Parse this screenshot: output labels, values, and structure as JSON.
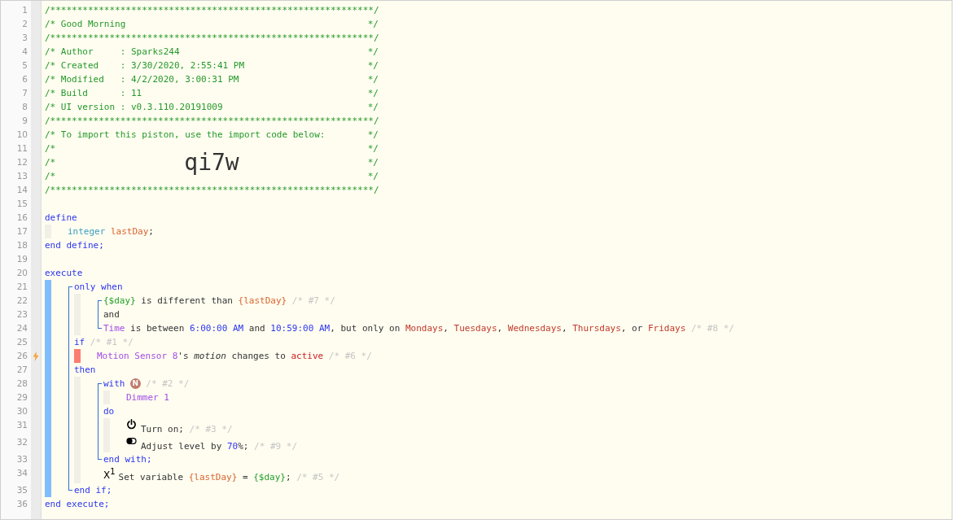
{
  "code": [
    {
      "number": "1",
      "kind": "banner",
      "trigger": false,
      "tokens": [
        {
          "kind": "comment",
          "text": "/************************************************************/"
        }
      ]
    },
    {
      "number": "2",
      "kind": "banner",
      "trigger": false,
      "tokens": [
        {
          "kind": "comment",
          "text": "/* Good Morning"
        },
        {
          "kind": "comment",
          "text": "*/"
        }
      ]
    },
    {
      "number": "3",
      "kind": "banner",
      "trigger": false,
      "tokens": [
        {
          "kind": "comment",
          "text": "/************************************************************/"
        }
      ]
    },
    {
      "number": "4",
      "kind": "banner",
      "trigger": false,
      "tokens": [
        {
          "kind": "comment",
          "text": "/* Author     : Sparks244"
        },
        {
          "kind": "comment",
          "text": "*/"
        }
      ]
    },
    {
      "number": "5",
      "kind": "banner",
      "trigger": false,
      "tokens": [
        {
          "kind": "comment",
          "text": "/* Created    : 3/30/2020, 2:55:41 PM"
        },
        {
          "kind": "comment",
          "text": "*/"
        }
      ]
    },
    {
      "number": "6",
      "kind": "banner",
      "trigger": false,
      "tokens": [
        {
          "kind": "comment",
          "text": "/* Modified   : 4/2/2020, 3:00:31 PM"
        },
        {
          "kind": "comment",
          "text": "*/"
        }
      ]
    },
    {
      "number": "7",
      "kind": "banner",
      "trigger": false,
      "tokens": [
        {
          "kind": "comment",
          "text": "/* Build      : 11"
        },
        {
          "kind": "comment",
          "text": "*/"
        }
      ]
    },
    {
      "number": "8",
      "kind": "banner",
      "trigger": false,
      "tokens": [
        {
          "kind": "comment",
          "text": "/* UI version : v0.3.110.20191009"
        },
        {
          "kind": "comment",
          "text": "*/"
        }
      ]
    },
    {
      "number": "9",
      "kind": "banner",
      "trigger": false,
      "tokens": [
        {
          "kind": "comment",
          "text": "/************************************************************/"
        }
      ]
    },
    {
      "number": "10",
      "kind": "banner",
      "trigger": false,
      "tokens": [
        {
          "kind": "comment",
          "text": "/* To import this piston, use the import code below:"
        },
        {
          "kind": "comment",
          "text": "*/"
        }
      ]
    },
    {
      "number": "11",
      "kind": "banner",
      "trigger": false,
      "tokens": [
        {
          "kind": "comment",
          "text": "/*"
        },
        {
          "kind": "comment",
          "text": "*/"
        }
      ]
    },
    {
      "number": "12",
      "kind": "banner",
      "trigger": false,
      "tokens": [
        {
          "kind": "comment",
          "text": "/*"
        },
        {
          "kind": "code",
          "text": "qi7w"
        },
        {
          "kind": "comment",
          "text": "*/"
        }
      ]
    },
    {
      "number": "13",
      "kind": "banner",
      "trigger": false,
      "tokens": [
        {
          "kind": "comment",
          "text": "/*"
        },
        {
          "kind": "comment",
          "text": "*/"
        }
      ]
    },
    {
      "number": "14",
      "kind": "banner",
      "trigger": false,
      "tokens": [
        {
          "kind": "comment",
          "text": "/************************************************************/"
        }
      ]
    },
    {
      "number": "15",
      "kind": "code",
      "trigger": false
    },
    {
      "number": "16",
      "kind": "code",
      "trigger": false,
      "tokens": [
        {
          "kind": "keyword",
          "text": "define"
        }
      ]
    },
    {
      "kind": "group",
      "items": [
        {
          "number": "17",
          "kind": "code",
          "trigger": false,
          "tokens": [
            {
              "kind": "type",
              "text": "integer"
            },
            {
              "kind": "var",
              "text": "lastDay"
            },
            {
              "kind": "plain",
              "text": ";"
            }
          ]
        }
      ]
    },
    {
      "number": "18",
      "kind": "code",
      "trigger": false,
      "tokens": [
        {
          "kind": "keyword",
          "text": "end define;"
        }
      ]
    },
    {
      "number": "19",
      "kind": "code",
      "trigger": false
    },
    {
      "number": "20",
      "kind": "code",
      "trigger": false,
      "tokens": [
        {
          "kind": "keyword",
          "text": "execute"
        }
      ]
    },
    {
      "kind": "statement",
      "items": [
        {
          "kind": "bracket",
          "items": [
            {
              "number": "21",
              "kind": "code",
              "trigger": false,
              "tokens": [
                {
                  "kind": "keyword",
                  "text": "only when"
                }
              ]
            },
            {
              "kind": "group",
              "items": [
                {
                  "kind": "bracket",
                  "items": [
                    {
                      "number": "22",
                      "kind": "code",
                      "trigger": false,
                      "tokens": [
                        {
                          "kind": "sysvar",
                          "text": "{$day}"
                        },
                        {
                          "kind": "plain",
                          "text": " is different than "
                        },
                        {
                          "kind": "var",
                          "text": "{lastDay}"
                        },
                        {
                          "kind": "note",
                          "text": "/* #7 */"
                        }
                      ]
                    },
                    {
                      "number": "23",
                      "kind": "code",
                      "trigger": false,
                      "tokens": [
                        {
                          "kind": "plain",
                          "text": "and"
                        }
                      ]
                    },
                    {
                      "number": "24",
                      "kind": "code",
                      "trigger": false,
                      "tokens": [
                        {
                          "kind": "device",
                          "text": "Time"
                        },
                        {
                          "kind": "plain",
                          "text": " is between "
                        },
                        {
                          "kind": "value",
                          "text": "6:00:00 AM"
                        },
                        {
                          "kind": "plain",
                          "text": " and "
                        },
                        {
                          "kind": "value",
                          "text": "10:59:00 AM"
                        },
                        {
                          "kind": "plain",
                          "text": ", but only on "
                        },
                        {
                          "kind": "enum",
                          "text": "Mondays"
                        },
                        {
                          "kind": "plain",
                          "text": ", "
                        },
                        {
                          "kind": "enum",
                          "text": "Tuesdays"
                        },
                        {
                          "kind": "plain",
                          "text": ", "
                        },
                        {
                          "kind": "enum",
                          "text": "Wednesdays"
                        },
                        {
                          "kind": "plain",
                          "text": ", "
                        },
                        {
                          "kind": "enum",
                          "text": "Thursdays"
                        },
                        {
                          "kind": "plain",
                          "text": ", or "
                        },
                        {
                          "kind": "enum",
                          "text": "Fridays"
                        },
                        {
                          "kind": "note",
                          "text": "/* #8 */"
                        }
                      ]
                    }
                  ]
                }
              ]
            },
            {
              "number": "25",
              "kind": "code",
              "trigger": false,
              "tokens": [
                {
                  "kind": "keyword",
                  "text": "if"
                },
                {
                  "kind": "note",
                  "text": "/* #1 */"
                }
              ]
            },
            {
              "kind": "trigger",
              "items": [
                {
                  "number": "26",
                  "kind": "code",
                  "trigger": true,
                  "tokens": [
                    {
                      "kind": "device",
                      "text": "Motion Sensor 8"
                    },
                    {
                      "kind": "plain",
                      "text": "'s "
                    },
                    {
                      "kind": "attr",
                      "text": "motion"
                    },
                    {
                      "kind": "plain",
                      "text": " changes to "
                    },
                    {
                      "kind": "active",
                      "text": "active"
                    },
                    {
                      "kind": "note",
                      "text": "/* #6 */"
                    }
                  ]
                }
              ]
            },
            {
              "number": "27",
              "kind": "code",
              "trigger": false,
              "tokens": [
                {
                  "kind": "keyword",
                  "text": "then"
                }
              ]
            },
            {
              "kind": "group",
              "items": [
                {
                  "kind": "bracket",
                  "items": [
                    {
                      "number": "28",
                      "kind": "code",
                      "trigger": false,
                      "tokens": [
                        {
                          "kind": "keyword",
                          "text": "with"
                        },
                        {
                          "kind": "badge",
                          "text": "N"
                        },
                        {
                          "kind": "note",
                          "text": "/* #2 */"
                        }
                      ]
                    },
                    {
                      "kind": "group",
                      "items": [
                        {
                          "number": "29",
                          "kind": "code",
                          "trigger": false,
                          "tokens": [
                            {
                              "kind": "device",
                              "text": "Dimmer 1"
                            }
                          ]
                        }
                      ]
                    },
                    {
                      "number": "30",
                      "kind": "code",
                      "trigger": false,
                      "tokens": [
                        {
                          "kind": "keyword",
                          "text": "do"
                        }
                      ]
                    },
                    {
                      "kind": "group",
                      "items": [
                        {
                          "number": "31",
                          "kind": "power",
                          "trigger": false,
                          "tokens": [
                            {
                              "kind": "plain",
                              "text": "Turn on;"
                            },
                            {
                              "kind": "note",
                              "text": "/* #3 */"
                            }
                          ]
                        },
                        {
                          "number": "32",
                          "kind": "toggle",
                          "trigger": false,
                          "tokens": [
                            {
                              "kind": "plain",
                              "text": "Adjust level by "
                            },
                            {
                              "kind": "value",
                              "text": "70"
                            },
                            {
                              "kind": "plain",
                              "text": "%;"
                            },
                            {
                              "kind": "note",
                              "text": "/* #9 */"
                            }
                          ]
                        }
                      ]
                    },
                    {
                      "number": "33",
                      "kind": "code",
                      "trigger": false,
                      "tokens": [
                        {
                          "kind": "keyword",
                          "text": "end with;"
                        }
                      ]
                    }
                  ]
                },
                {
                  "number": "34",
                  "kind": "code",
                  "trigger": false,
                  "tokens": [
                    {
                      "kind": "symbol",
                      "text": "X$^{1}$"
                    },
                    {
                      "kind": "plain",
                      "text": "Set variable "
                    },
                    {
                      "kind": "var",
                      "text": "{lastDay}"
                    },
                    {
                      "kind": "plain",
                      "text": " = "
                    },
                    {
                      "kind": "sysvar",
                      "text": "{$day}"
                    },
                    {
                      "kind": "plain",
                      "text": ";"
                    },
                    {
                      "kind": "note",
                      "text": "/* #5 */"
                    }
                  ]
                }
              ]
            },
            {
              "number": "35",
              "kind": "code",
              "trigger": false,
              "tokens": [
                {
                  "kind": "keyword",
                  "text": "end if;"
                }
              ]
            }
          ]
        }
      ]
    },
    {
      "number": "36",
      "kind": "code",
      "trigger": false,
      "tokens": [
        {
          "kind": "keyword",
          "text": "end execute;"
        }
      ]
    }
  ]
}
